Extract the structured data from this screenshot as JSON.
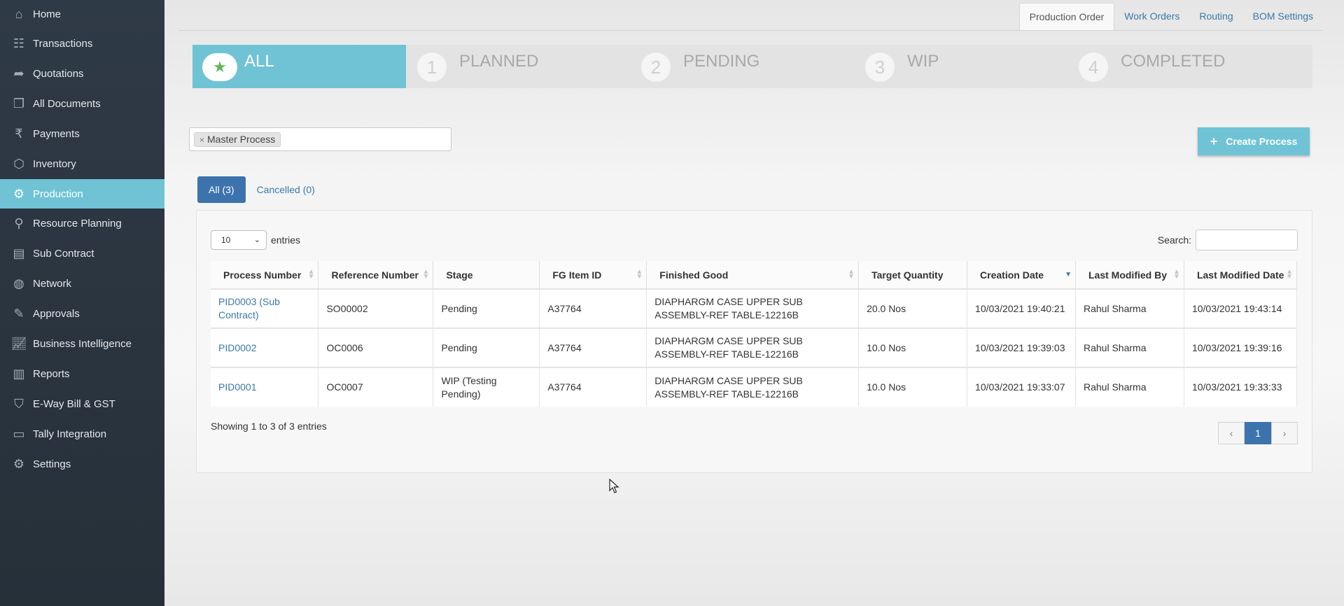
{
  "sidebar": {
    "items": [
      {
        "label": "Home",
        "icon": "home-icon"
      },
      {
        "label": "Transactions",
        "icon": "transactions-icon"
      },
      {
        "label": "Quotations",
        "icon": "quotations-icon"
      },
      {
        "label": "All Documents",
        "icon": "documents-icon"
      },
      {
        "label": "Payments",
        "icon": "rupee-icon"
      },
      {
        "label": "Inventory",
        "icon": "box-icon"
      },
      {
        "label": "Production",
        "icon": "production-icon",
        "active": true
      },
      {
        "label": "Resource Planning",
        "icon": "resource-icon"
      },
      {
        "label": "Sub Contract",
        "icon": "file-icon"
      },
      {
        "label": "Network",
        "icon": "globe-icon"
      },
      {
        "label": "Approvals",
        "icon": "approvals-icon"
      },
      {
        "label": "Business Intelligence",
        "icon": "chart-icon"
      },
      {
        "label": "Reports",
        "icon": "book-icon"
      },
      {
        "label": "E-Way Bill & GST",
        "icon": "shield-icon"
      },
      {
        "label": "Tally Integration",
        "icon": "monitor-icon"
      },
      {
        "label": "Settings",
        "icon": "gear-icon"
      }
    ]
  },
  "top_tabs": [
    "Production Order",
    "Work Orders",
    "Routing",
    "BOM Settings"
  ],
  "stepper": [
    {
      "num": "★",
      "label": "ALL"
    },
    {
      "num": "1",
      "label": "PLANNED"
    },
    {
      "num": "2",
      "label": "PENDING"
    },
    {
      "num": "3",
      "label": "WIP"
    },
    {
      "num": "4",
      "label": "COMPLETED"
    }
  ],
  "filter": {
    "chip_remove": "×",
    "chip_label": "Master Process"
  },
  "create_button": {
    "plus": "+",
    "label": "Create Process"
  },
  "sub_tabs": [
    "All (3)",
    "Cancelled (0)"
  ],
  "entries": {
    "value": "10",
    "suffix": "entries"
  },
  "search": {
    "label": "Search:"
  },
  "table": {
    "columns": [
      "Process Number",
      "Reference Number",
      "Stage",
      "FG Item ID",
      "Finished Good",
      "Target Quantity",
      "Creation Date",
      "Last Modified By",
      "Last Modified Date"
    ],
    "rows": [
      [
        "PID0003 (Sub Contract)",
        "SO00002",
        "Pending",
        "A37764",
        "DIAPHARGM CASE UPPER SUB ASSEMBLY-REF TABLE-12216B",
        "20.0 Nos",
        "10/03/2021 19:40:21",
        "Rahul Sharma",
        "10/03/2021 19:43:14"
      ],
      [
        "PID0002",
        "OC0006",
        "Pending",
        "A37764",
        "DIAPHARGM CASE UPPER SUB ASSEMBLY-REF TABLE-12216B",
        "10.0 Nos",
        "10/03/2021 19:39:03",
        "Rahul Sharma",
        "10/03/2021 19:39:16"
      ],
      [
        "PID0001",
        "OC0007",
        "WIP (Testing Pending)",
        "A37764",
        "DIAPHARGM CASE UPPER SUB ASSEMBLY-REF TABLE-12216B",
        "10.0 Nos",
        "10/03/2021 19:33:07",
        "Rahul Sharma",
        "10/03/2021 19:33:33"
      ]
    ]
  },
  "footer": {
    "showing": "Showing 1 to 3 of 3 entries"
  },
  "pager": {
    "prev": "‹",
    "current": "1",
    "next": "›"
  }
}
